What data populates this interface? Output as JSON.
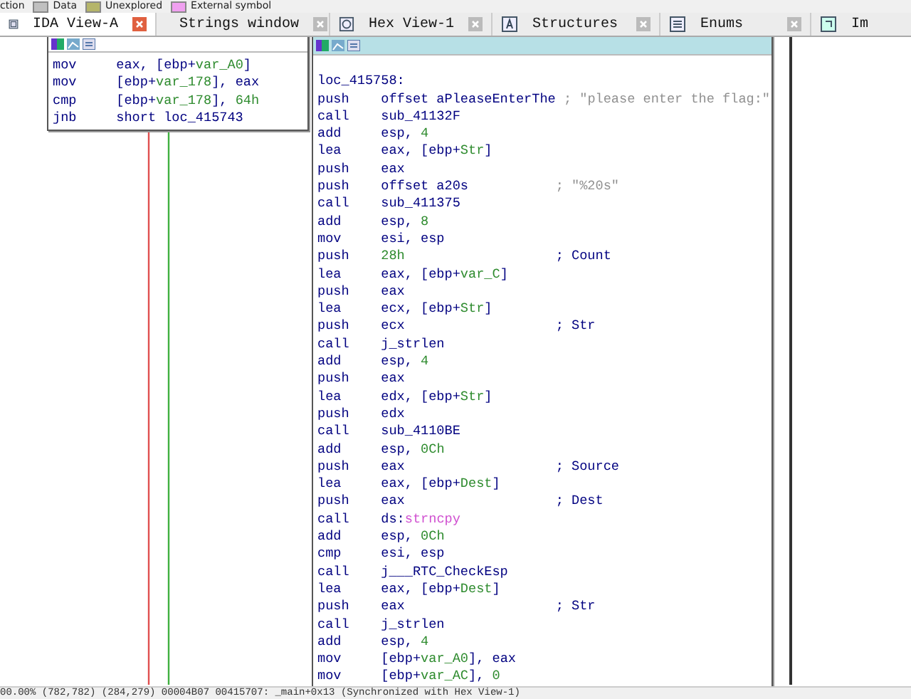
{
  "legend": [
    {
      "label": "ction"
    },
    {
      "label": "Data",
      "color": "#c0c0c0"
    },
    {
      "label": "Unexplored",
      "color": "#b5b56a"
    },
    {
      "label": "External symbol",
      "color": "#f0a0f0"
    }
  ],
  "tabs": [
    {
      "label": "IDA View-A",
      "selected": true
    },
    {
      "label": "Strings window",
      "selected": false
    },
    {
      "label": "Hex View-1",
      "selected": false
    },
    {
      "label": "Structures",
      "selected": false
    },
    {
      "label": "Enums",
      "selected": false
    },
    {
      "label": "Im",
      "selected": false
    }
  ],
  "nodes": [
    {
      "selected": false,
      "lines": [
        {
          "op": "mov",
          "args": [
            {
              "text": "eax, [ebp+",
              "kind": "plain"
            },
            {
              "text": "var_A0",
              "kind": "var"
            },
            {
              "text": "]",
              "kind": "plain"
            }
          ]
        },
        {
          "op": "mov",
          "args": [
            {
              "text": "[ebp+",
              "kind": "plain"
            },
            {
              "text": "var_178",
              "kind": "var"
            },
            {
              "text": "], eax",
              "kind": "plain"
            }
          ]
        },
        {
          "op": "cmp",
          "args": [
            {
              "text": "[ebp+",
              "kind": "plain"
            },
            {
              "text": "var_178",
              "kind": "var"
            },
            {
              "text": "], ",
              "kind": "plain"
            },
            {
              "text": "64h",
              "kind": "num"
            }
          ]
        },
        {
          "op": "jnb",
          "args": [
            {
              "text": "short loc_415743",
              "kind": "plain"
            }
          ]
        }
      ]
    },
    {
      "selected": true,
      "label": "loc_415758:",
      "lines": [
        {
          "op": "push",
          "args": [
            {
              "text": "offset aPleaseEnterThe",
              "kind": "plain"
            }
          ],
          "comment": {
            "text": "; \"please enter the flag:\"",
            "kind": "string"
          }
        },
        {
          "op": "call",
          "args": [
            {
              "text": "sub_41132F",
              "kind": "plain"
            }
          ]
        },
        {
          "op": "add",
          "args": [
            {
              "text": "esp, ",
              "kind": "plain"
            },
            {
              "text": "4",
              "kind": "num"
            }
          ]
        },
        {
          "op": "lea",
          "args": [
            {
              "text": "eax, [ebp+",
              "kind": "plain"
            },
            {
              "text": "Str",
              "kind": "var"
            },
            {
              "text": "]",
              "kind": "plain"
            }
          ]
        },
        {
          "op": "push",
          "args": [
            {
              "text": "eax",
              "kind": "plain"
            }
          ]
        },
        {
          "op": "push",
          "args": [
            {
              "text": "offset a20s",
              "kind": "plain"
            }
          ],
          "comment": {
            "text": "; \"%20s\"",
            "kind": "string"
          }
        },
        {
          "op": "call",
          "args": [
            {
              "text": "sub_411375",
              "kind": "plain"
            }
          ]
        },
        {
          "op": "add",
          "args": [
            {
              "text": "esp, ",
              "kind": "plain"
            },
            {
              "text": "8",
              "kind": "num"
            }
          ]
        },
        {
          "op": "mov",
          "args": [
            {
              "text": "esi, esp",
              "kind": "plain"
            }
          ]
        },
        {
          "op": "push",
          "args": [
            {
              "text": "28h",
              "kind": "num"
            }
          ],
          "comment": {
            "text": "; Count",
            "kind": "plain"
          }
        },
        {
          "op": "lea",
          "args": [
            {
              "text": "eax, [ebp+",
              "kind": "plain"
            },
            {
              "text": "var_C",
              "kind": "var"
            },
            {
              "text": "]",
              "kind": "plain"
            }
          ]
        },
        {
          "op": "push",
          "args": [
            {
              "text": "eax",
              "kind": "plain"
            }
          ]
        },
        {
          "op": "lea",
          "args": [
            {
              "text": "ecx, [ebp+",
              "kind": "plain"
            },
            {
              "text": "Str",
              "kind": "var"
            },
            {
              "text": "]",
              "kind": "plain"
            }
          ]
        },
        {
          "op": "push",
          "args": [
            {
              "text": "ecx",
              "kind": "plain"
            }
          ],
          "comment": {
            "text": "; Str",
            "kind": "plain"
          }
        },
        {
          "op": "call",
          "args": [
            {
              "text": "j_strlen",
              "kind": "plain"
            }
          ]
        },
        {
          "op": "add",
          "args": [
            {
              "text": "esp, ",
              "kind": "plain"
            },
            {
              "text": "4",
              "kind": "num"
            }
          ]
        },
        {
          "op": "push",
          "args": [
            {
              "text": "eax",
              "kind": "plain"
            }
          ]
        },
        {
          "op": "lea",
          "args": [
            {
              "text": "edx, [ebp+",
              "kind": "plain"
            },
            {
              "text": "Str",
              "kind": "var"
            },
            {
              "text": "]",
              "kind": "plain"
            }
          ]
        },
        {
          "op": "push",
          "args": [
            {
              "text": "edx",
              "kind": "plain"
            }
          ]
        },
        {
          "op": "call",
          "args": [
            {
              "text": "sub_4110BE",
              "kind": "plain"
            }
          ]
        },
        {
          "op": "add",
          "args": [
            {
              "text": "esp, ",
              "kind": "plain"
            },
            {
              "text": "0Ch",
              "kind": "num"
            }
          ]
        },
        {
          "op": "push",
          "args": [
            {
              "text": "eax",
              "kind": "plain"
            }
          ],
          "comment": {
            "text": "; Source",
            "kind": "plain"
          }
        },
        {
          "op": "lea",
          "args": [
            {
              "text": "eax, [ebp+",
              "kind": "plain"
            },
            {
              "text": "Dest",
              "kind": "var"
            },
            {
              "text": "]",
              "kind": "plain"
            }
          ]
        },
        {
          "op": "push",
          "args": [
            {
              "text": "eax",
              "kind": "plain"
            }
          ],
          "comment": {
            "text": "; Dest",
            "kind": "plain"
          }
        },
        {
          "op": "call",
          "args": [
            {
              "text": "ds:",
              "kind": "plain"
            },
            {
              "text": "strncpy",
              "kind": "import"
            }
          ]
        },
        {
          "op": "add",
          "args": [
            {
              "text": "esp, ",
              "kind": "plain"
            },
            {
              "text": "0Ch",
              "kind": "num"
            }
          ]
        },
        {
          "op": "cmp",
          "args": [
            {
              "text": "esi, esp",
              "kind": "plain"
            }
          ]
        },
        {
          "op": "call",
          "args": [
            {
              "text": "j___RTC_CheckEsp",
              "kind": "plain"
            }
          ]
        },
        {
          "op": "lea",
          "args": [
            {
              "text": "eax, [ebp+",
              "kind": "plain"
            },
            {
              "text": "Dest",
              "kind": "var"
            },
            {
              "text": "]",
              "kind": "plain"
            }
          ]
        },
        {
          "op": "push",
          "args": [
            {
              "text": "eax",
              "kind": "plain"
            }
          ],
          "comment": {
            "text": "; Str",
            "kind": "plain"
          }
        },
        {
          "op": "call",
          "args": [
            {
              "text": "j_strlen",
              "kind": "plain"
            }
          ]
        },
        {
          "op": "add",
          "args": [
            {
              "text": "esp, ",
              "kind": "plain"
            },
            {
              "text": "4",
              "kind": "num"
            }
          ]
        },
        {
          "op": "mov",
          "args": [
            {
              "text": "[ebp+",
              "kind": "plain"
            },
            {
              "text": "var_A0",
              "kind": "var"
            },
            {
              "text": "], eax",
              "kind": "plain"
            }
          ]
        },
        {
          "op": "mov",
          "args": [
            {
              "text": "[ebp+",
              "kind": "plain"
            },
            {
              "text": "var_AC",
              "kind": "var"
            },
            {
              "text": "], ",
              "kind": "plain"
            },
            {
              "text": "0",
              "kind": "num"
            }
          ]
        }
      ]
    }
  ],
  "status_bar": "00.00% (782,782) (284,279) 00004B07 00415707: _main+0x13 (Synchronized with Hex View-1)"
}
